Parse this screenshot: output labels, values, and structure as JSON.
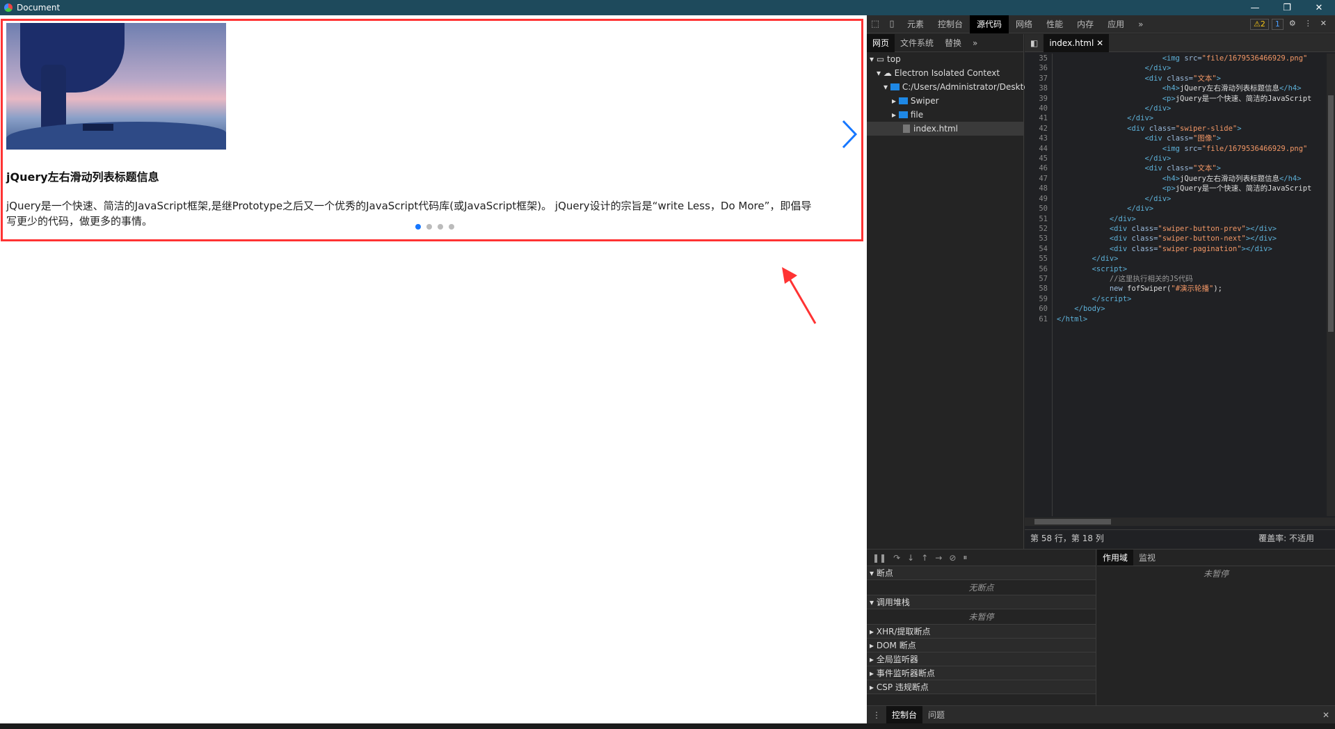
{
  "window": {
    "title": "Document",
    "minimize": "—",
    "restore": "❐",
    "close": "✕"
  },
  "swiper": {
    "title": "jQuery左右滑动列表标题信息",
    "text_line1": "jQuery是一个快速、简洁的JavaScript框架,是继Prototype之后又一个优秀的JavaScript代码库(或JavaScript框架)。 jQuery设计的宗旨是“write Less，Do More”，即倡导",
    "text_line2": "写更少的代码，做更多的事情。",
    "slides_total": 4,
    "active_slide": 1
  },
  "devtools": {
    "tabs": [
      "元素",
      "控制台",
      "源代码",
      "网络",
      "性能",
      "内存",
      "应用"
    ],
    "active_tab": "源代码",
    "more": "»",
    "warnings": "⚠2",
    "messages": "1",
    "sources_tabs": [
      "网页",
      "文件系统",
      "替换"
    ],
    "tree": {
      "top": "top",
      "context": "Electron Isolated Context",
      "path": "C:/Users/Administrator/Deskto",
      "folder1": "Swiper",
      "folder2": "file",
      "file": "index.html"
    },
    "editor_tab": "index.html",
    "status_pos": "第 58 行，第 18 列",
    "status_cov": "覆盖率: 不适用",
    "sections": {
      "breakpoints": "断点",
      "no_breakpoints": "无断点",
      "callstack": "调用堆栈",
      "not_paused": "未暂停",
      "xhr": "XHR/提取断点",
      "dom": "DOM 断点",
      "global": "全局监听器",
      "event": "事件监听器断点",
      "csp": "CSP 违规断点"
    },
    "scope_tabs": [
      "作用域",
      "监视"
    ],
    "scope_empty": "未暂停",
    "drawer_tabs": [
      "控制台",
      "问题"
    ]
  }
}
